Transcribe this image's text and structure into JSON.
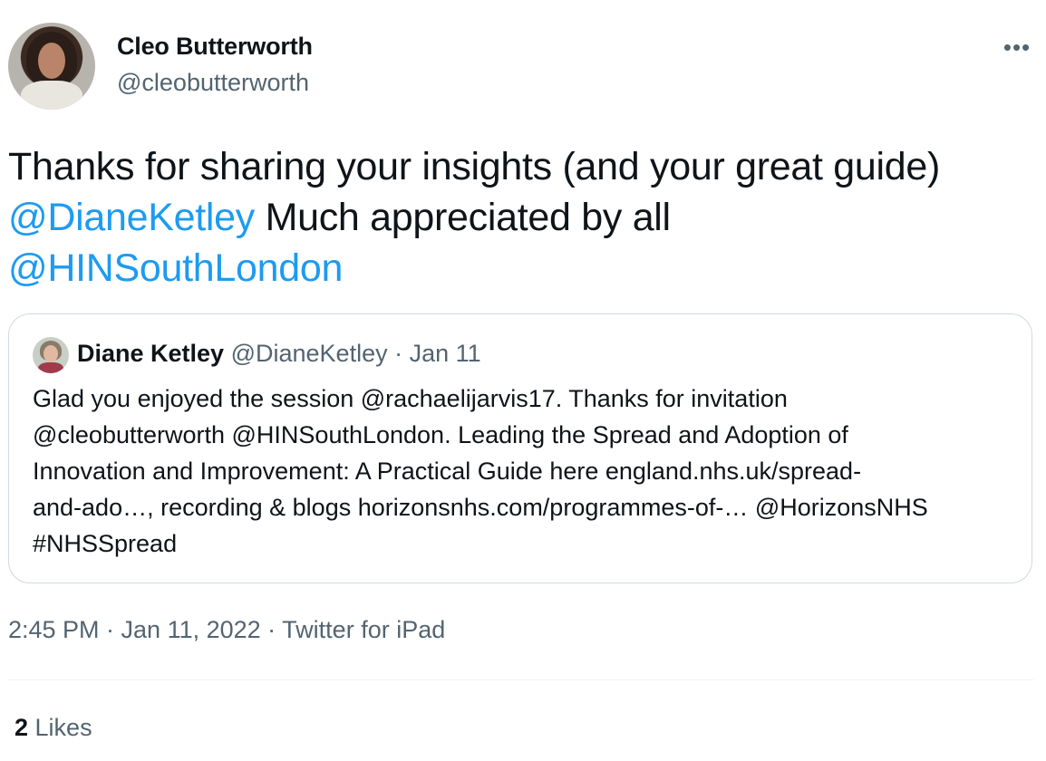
{
  "author": {
    "name": "Cleo Butterworth",
    "handle": "@cleobutterworth"
  },
  "more_icon": "more-horizontal-icon",
  "tweet": {
    "text_part1": "Thanks for sharing your insights (and your great guide)",
    "mention1": "@DianeKetley",
    "text_part2": " Much appreciated by all",
    "mention2": "@HINSouthLondon"
  },
  "quoted": {
    "name": "Diane Ketley",
    "handle": "@DianeKetley",
    "separator": " · ",
    "date": "Jan 11",
    "lines": [
      "Glad you enjoyed the session @rachaelijarvis17. Thanks for invitation",
      "@cleobutterworth @HINSouthLondon. Leading the Spread and Adoption of",
      "Innovation and Improvement: A Practical Guide here england.nhs.uk/spread-",
      "and-ado…, recording & blogs horizonsnhs.com/programmes-of-… @HorizonsNHS",
      "#NHSSpread"
    ]
  },
  "timestamp": "2:45 PM · Jan 11, 2022 · Twitter for iPad",
  "likes": {
    "count": "2",
    "label": " Likes"
  },
  "colors": {
    "link": "#1d9bf0",
    "secondary_text": "#536471",
    "border": "#cfd9de"
  }
}
